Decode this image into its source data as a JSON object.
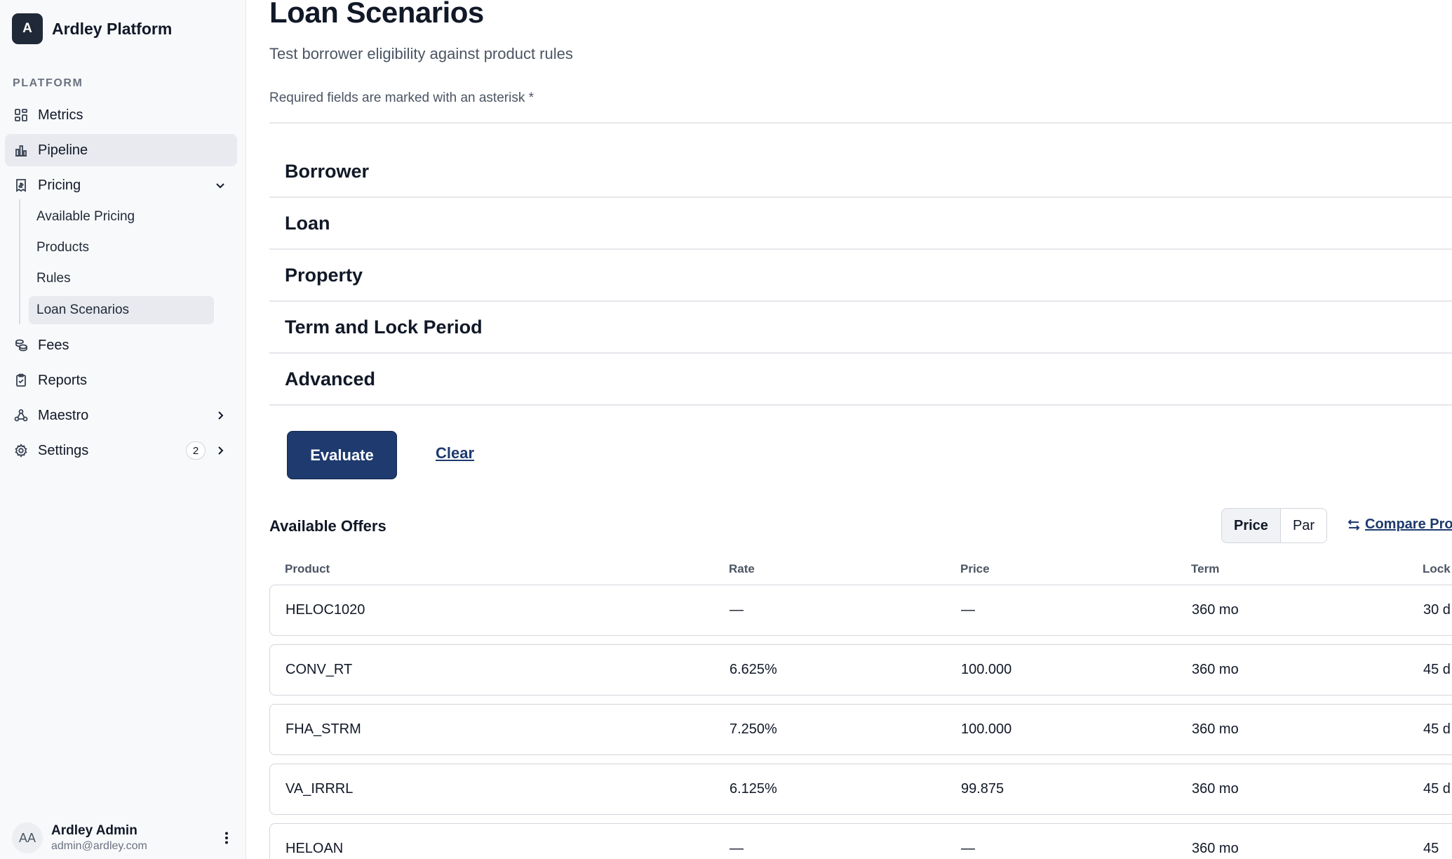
{
  "brand": {
    "logo_letter": "A",
    "name": "Ardley Platform"
  },
  "sidebar": {
    "section_label": "PLATFORM",
    "items": [
      {
        "label": "Metrics",
        "icon": "dashboard-icon"
      },
      {
        "label": "Pipeline",
        "icon": "bar-chart-icon",
        "active": true
      },
      {
        "label": "Pricing",
        "icon": "receipt-icon",
        "expanded": true
      },
      {
        "label": "Fees",
        "icon": "coins-icon"
      },
      {
        "label": "Reports",
        "icon": "clipboard-icon"
      },
      {
        "label": "Maestro",
        "icon": "workflow-icon"
      },
      {
        "label": "Settings",
        "icon": "gear-icon",
        "badge": "2"
      }
    ],
    "pricing_sub": [
      {
        "label": "Available Pricing"
      },
      {
        "label": "Products"
      },
      {
        "label": "Rules"
      },
      {
        "label": "Loan Scenarios",
        "active": true
      }
    ],
    "user": {
      "initials": "AA",
      "name": "Ardley Admin",
      "email": "admin@ardley.com"
    }
  },
  "main": {
    "title": "Loan Scenarios",
    "subtitle": "Test borrower eligibility against product rules",
    "required_note": "Required fields are marked with an asterisk *",
    "sections": [
      "Borrower",
      "Loan",
      "Property",
      "Term and Lock Period",
      "Advanced"
    ],
    "evaluate_label": "Evaluate",
    "clear_label": "Clear",
    "offers": {
      "title": "Available Offers",
      "toggle": {
        "price": "Price",
        "par": "Par",
        "selected": "Price"
      },
      "compare_label": "Compare Pro",
      "columns": [
        "Product",
        "Rate",
        "Price",
        "Term",
        "Lock"
      ],
      "rows": [
        {
          "product": "HELOC1020",
          "rate": "—",
          "price": "—",
          "term": "360 mo",
          "lock": "30 d"
        },
        {
          "product": "CONV_RT",
          "rate": "6.625%",
          "price": "100.000",
          "term": "360 mo",
          "lock": "45 d"
        },
        {
          "product": "FHA_STRM",
          "rate": "7.250%",
          "price": "100.000",
          "term": "360 mo",
          "lock": "45 d"
        },
        {
          "product": "VA_IRRRL",
          "rate": "6.125%",
          "price": "99.875",
          "term": "360 mo",
          "lock": "45 d"
        },
        {
          "product": "HELOAN",
          "rate": "—",
          "price": "—",
          "term": "360 mo",
          "lock": "45"
        }
      ]
    }
  },
  "colors": {
    "primary": "#1e3a6e",
    "sidebar_bg": "#f8f9fb",
    "active_bg": "#e8eaef",
    "border": "#d1d5db"
  }
}
